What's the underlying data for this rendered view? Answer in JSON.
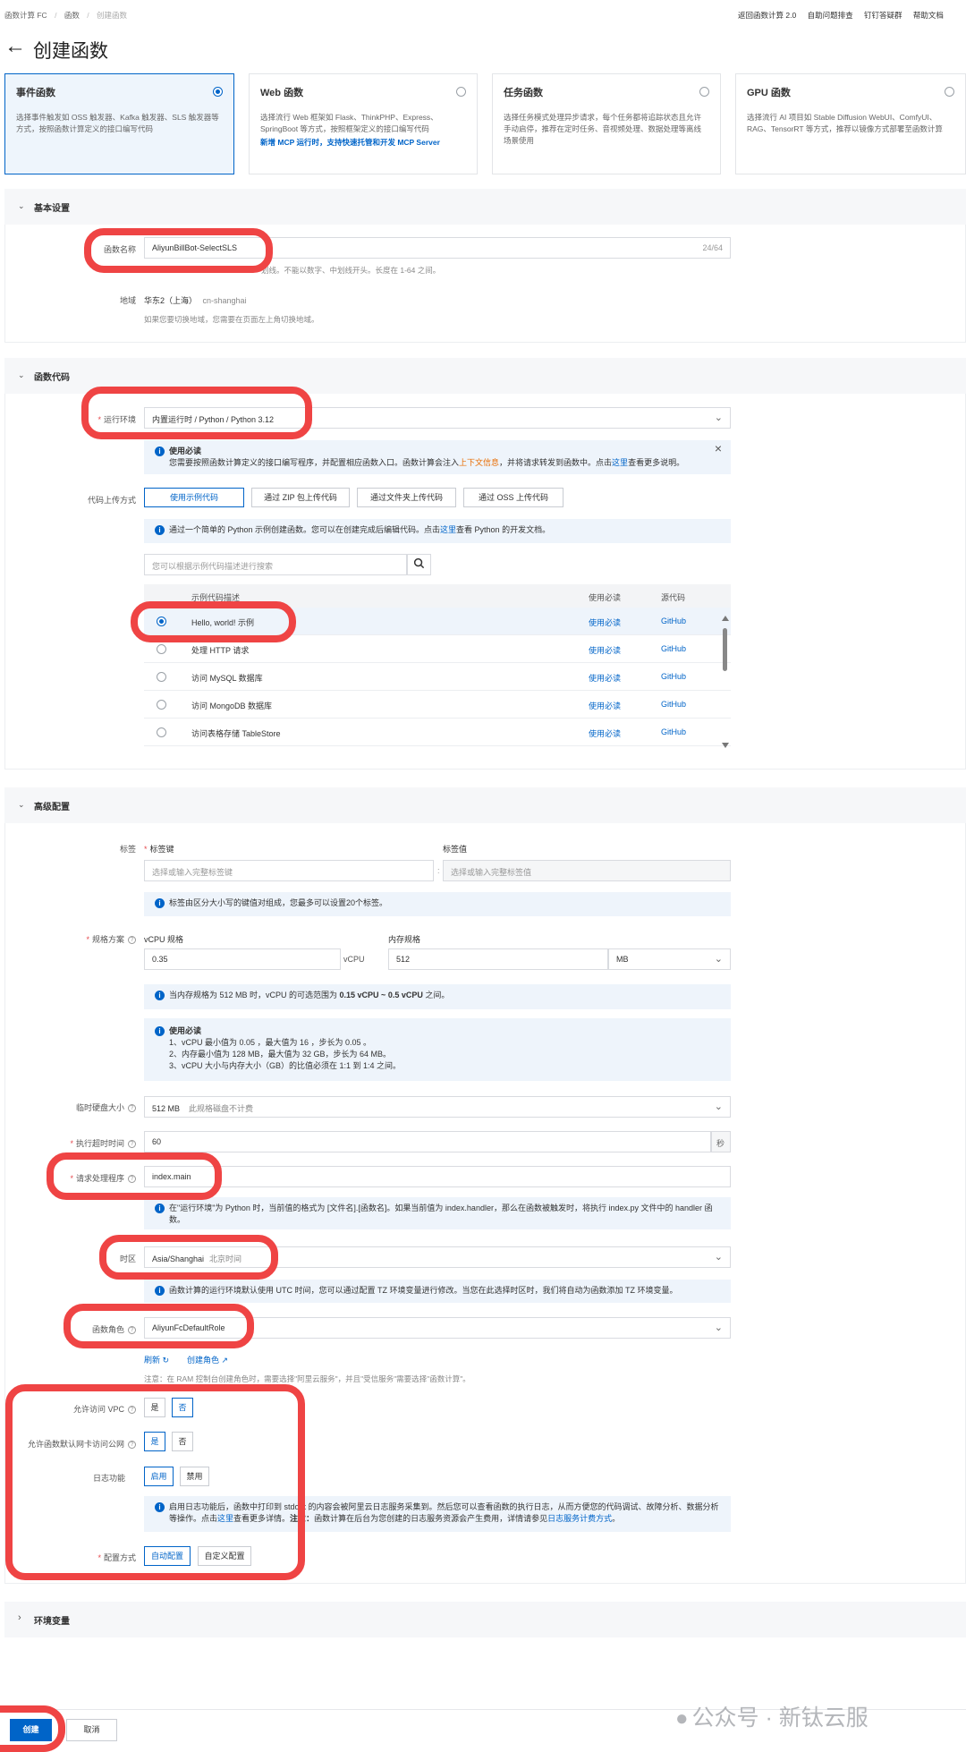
{
  "breadcrumb": {
    "items": [
      "函数计算 FC",
      "函数",
      "创建函数"
    ]
  },
  "top_links": [
    "返回函数计算 2.0",
    "自助问题排查",
    "钉钉答疑群",
    "帮助文档"
  ],
  "page_title": "创建函数",
  "function_types": [
    {
      "title": "事件函数",
      "desc": "选择事件触发如 OSS 触发器、Kafka 触发器、SLS 触发器等方式，按照函数计算定义的接口编写代码",
      "selected": true
    },
    {
      "title": "Web 函数",
      "desc": "选择流行 Web 框架如 Flask、ThinkPHP、Express、SpringBoot 等方式，按照框架定义的接口编写代码",
      "extra": "新增 MCP 运行时，支持快速托管和开发 MCP Server",
      "selected": false
    },
    {
      "title": "任务函数",
      "desc": "选择任务模式处理异步请求，每个任务都将追踪状态且允许手动启停，推荐在定时任务、音视频处理、数据处理等离线场景使用",
      "selected": false
    },
    {
      "title": "GPU 函数",
      "desc": "选择流行 AI 项目如 Stable Diffusion WebUI、ComfyUI、RAG、TensorRT 等方式，推荐以镜像方式部署至函数计算",
      "selected": false
    }
  ],
  "basic": {
    "section_title": "基本设置",
    "name_label": "函数名称",
    "name_value": "AliyunBillBot-SelectSLS",
    "name_count": "24/64",
    "name_hint": "划线。不能以数字、中划线开头。长度在 1-64 之间。",
    "region_label": "地域",
    "region_value": "华东2（上海）",
    "region_code": "cn-shanghai",
    "region_hint": "如果您要切换地域，您需要在页面左上角切换地域。"
  },
  "code": {
    "section_title": "函数代码",
    "runtime_label": "运行环境",
    "runtime_value": "内置运行时 / Python / Python 3.12",
    "notice_title": "使用必读",
    "notice_a": "您需要按照函数计算定义的接口编写程序，并配置相应函数入口。函数计算会注入",
    "notice_link1": "上下文信息",
    "notice_b": "，并将请求转发到函数中。点击",
    "notice_link2": "这里",
    "notice_c": "查看更多说明。",
    "upload_label": "代码上传方式",
    "upload_options": [
      "使用示例代码",
      "通过 ZIP 包上传代码",
      "通过文件夹上传代码",
      "通过 OSS 上传代码"
    ],
    "sample_info_a": "通过一个简单的 Python 示例创建函数。您可以在创建完成后编辑代码。点击",
    "sample_info_link": "这里",
    "sample_info_b": "查看 Python 的开发文档。",
    "search_placeholder": "您可以根据示例代码描述进行搜索",
    "table_headers": [
      "示例代码描述",
      "使用必读",
      "源代码"
    ],
    "table_rows": [
      {
        "desc": "Hello, world! 示例",
        "read": "使用必读",
        "src": "GitHub",
        "selected": true
      },
      {
        "desc": "处理 HTTP 请求",
        "read": "使用必读",
        "src": "GitHub",
        "selected": false
      },
      {
        "desc": "访问 MySQL 数据库",
        "read": "使用必读",
        "src": "GitHub",
        "selected": false
      },
      {
        "desc": "访问 MongoDB 数据库",
        "read": "使用必读",
        "src": "GitHub",
        "selected": false
      },
      {
        "desc": "访问表格存储 TableStore",
        "read": "使用必读",
        "src": "GitHub",
        "selected": false
      }
    ]
  },
  "advanced": {
    "section_title": "高级配置",
    "tag_label": "标签",
    "tag_key_label": "标签键",
    "tag_value_label": "标签值",
    "tag_key_placeholder": "选择或输入完整标签键",
    "tag_value_placeholder": "选择或输入完整标签值",
    "tag_info": "标签由区分大小写的键值对组成，您最多可以设置20个标签。",
    "spec_label": "规格方案",
    "vcpu_label": "vCPU 规格",
    "vcpu_value": "0.35",
    "vcpu_unit": "vCPU",
    "mem_label": "内存规格",
    "mem_value": "512",
    "mem_unit": "MB",
    "spec_info_a": "当内存规格为 512 MB 时，vCPU 的可选范围为 ",
    "spec_info_b": "0.15 vCPU ~ 0.5 vCPU",
    "spec_info_c": " 之间。",
    "spec_notice_title": "使用必读",
    "spec_notice_lines": [
      "1、vCPU 最小值为 0.05 ，最大值为 16 ，步长为 0.05 。",
      "2、内存最小值为 128 MB，最大值为 32 GB，步长为 64 MB。",
      "3、vCPU 大小与内存大小（GB）的比值必须在 1:1 到 1:4 之间。"
    ],
    "disk_label": "临时硬盘大小",
    "disk_value": "512 MB",
    "disk_note": "此规格磁盘不计费",
    "timeout_label": "执行超时时间",
    "timeout_value": "60",
    "timeout_unit": "秒",
    "handler_label": "请求处理程序",
    "handler_value": "index.main",
    "handler_info": "在\"运行环境\"为 Python 时，当前值的格式为 [文件名].[函数名]。如果当前值为 index.handler，那么在函数被触发时，将执行 index.py 文件中的 handler 函数。",
    "tz_label": "时区",
    "tz_value": "Asia/Shanghai",
    "tz_note": "北京时间",
    "tz_info": "函数计算的运行环境默认使用 UTC 时间，您可以通过配置 TZ 环境变量进行修改。当您在此选择时区时，我们将自动为函数添加 TZ 环境变量。",
    "role_label": "函数角色",
    "role_value": "AliyunFcDefaultRole",
    "refresh_label": "刷新",
    "create_role_label": "创建角色",
    "role_note": "注意：在 RAM 控制台创建角色时，需要选择\"阿里云服务\"，并且\"受信服务\"需要选择\"函数计算\"。",
    "vpc_label": "允许访问 VPC",
    "vpc_options": [
      "是",
      "否"
    ],
    "internet_label": "允许函数默认网卡访问公网",
    "internet_options": [
      "是",
      "否"
    ],
    "log_label": "日志功能",
    "log_options": [
      "启用",
      "禁用"
    ],
    "log_info_a": "启用日志功能后，函数中打印到 stdout 的内容会被阿里云日志服务采集到。然后您可以查看函数的执行日志，从而方便您的代码调试、故障分析、数据分析等操作。点击",
    "log_info_link1": "这里",
    "log_info_b": "查看更多详情。",
    "log_info_bold": "注意：",
    "log_info_c": "函数计算在后台为您创建的日志服务资源会产生费用，详情请参见",
    "log_info_link2": "日志服务计费方式",
    "log_info_d": "。",
    "config_label": "配置方式",
    "config_options": [
      "自动配置",
      "自定义配置"
    ]
  },
  "env": {
    "section_title": "环境变量"
  },
  "footer": {
    "create_label": "创建",
    "cancel_label": "取消"
  },
  "watermark": "公众号 · 新钛云服",
  "colors": {
    "accent": "#0064c8",
    "highlight": "#ef4444",
    "required": "#e5484d",
    "link_orange": "#e86b00"
  }
}
